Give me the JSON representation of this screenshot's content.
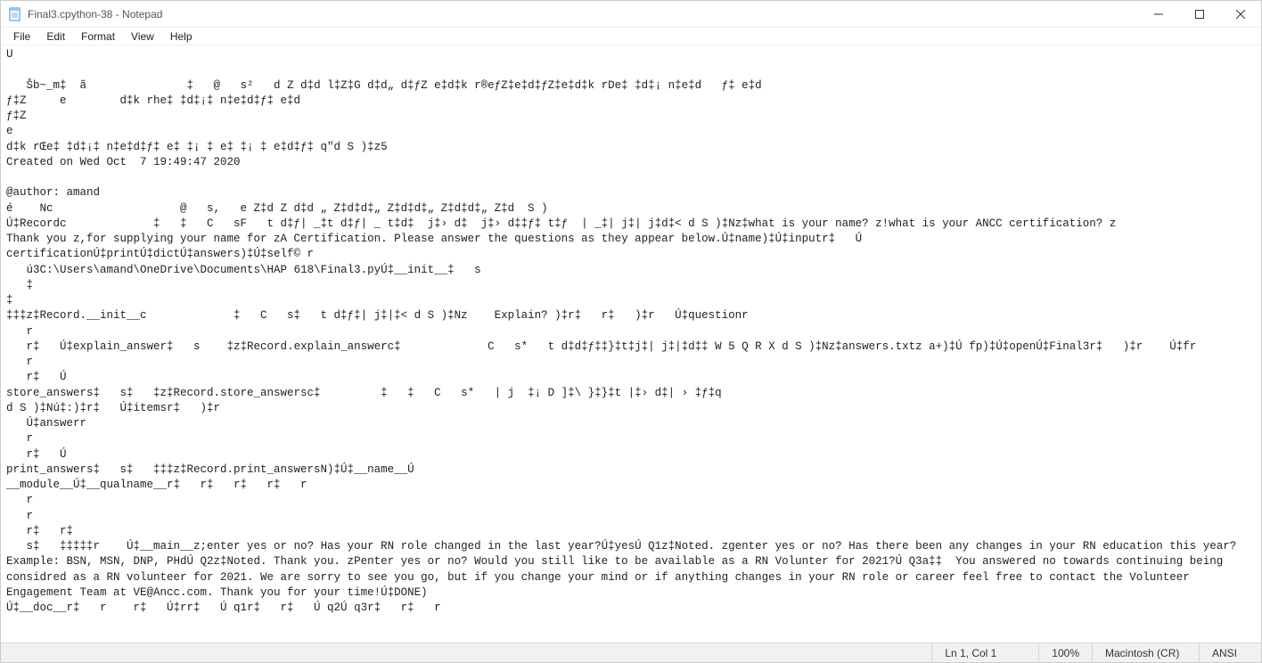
{
  "window": {
    "title": "Final3.cpython-38 - Notepad"
  },
  "menu": {
    "file": "File",
    "edit": "Edit",
    "format": "Format",
    "view": "View",
    "help": "Help"
  },
  "content": "U\n\n   Šb~_m‡  ã               ‡   @   s²   d Z d‡d l‡Z‡G d‡d„ d‡ƒZ e‡d‡k r®eƒZ‡e‡d‡ƒZ‡e‡d‡k rDe‡ ‡d‡¡ n‡e‡d   ƒ‡ e‡d\nƒ‡Z     e        d‡k rhe‡ ‡d‡¡‡ n‡e‡d‡ƒ‡ e‡d\nƒ‡Z\ne\nd‡k rŒe‡ ‡d‡¡‡ n‡e‡d‡ƒ‡ e‡ ‡¡ ‡ e‡ ‡¡ ‡ e‡d‡ƒ‡ q\"d S )‡z5\nCreated on Wed Oct  7 19:49:47 2020\n\n@author: amand\né    Nc                   @   s,   e Z‡d Z d‡d „ Z‡d‡d‡„ Z‡d‡d‡„ Z‡d‡d‡„ Z‡d  S )\nÚ‡Recordc             ‡   ‡   C   sF   t d‡ƒ| _‡t d‡ƒ| _ t‡d‡  j‡› d‡  j‡› d‡‡ƒ‡ t‡ƒ  | _‡| j‡| j‡d‡< d S )‡Nz‡what is your name? z!what is your ANCC certification? z\nThank you z,for supplying your name for zA Certification. Please answer the questions as they appear below.Ú‡name)‡Ú‡inputr‡   Ú\ncertificationÚ‡printÚ‡dictÚ‡answers)‡Ú‡self© r\n   ú3C:\\Users\\amand\\OneDrive\\Documents\\HAP 618\\Final3.pyÚ‡__init__‡   s\n   ‡\n‡\n‡‡‡z‡Record.__init__c             ‡   C   s‡   t d‡ƒ‡| j‡|‡< d S )‡Nz    Explain? )‡r‡   r‡   )‡r   Ú‡questionr\n   r\n   r‡   Ú‡explain_answer‡   s    ‡z‡Record.explain_answerc‡             C   s*   t d‡d‡ƒ‡‡}‡t‡j‡| j‡|‡d‡‡ W 5 Q R X d S )‡Nz‡answers.txtz a+)‡Ú fp)‡Ú‡openÚ‡Final3r‡   )‡r    Ú‡fr\n   r\n   r‡   Ú\nstore_answers‡   s‡   ‡z‡Record.store_answersc‡         ‡   ‡   C   s*   | j  ‡¡ D ]‡\\ }‡}‡t |‡› d‡| › ‡ƒ‡q\nd S )‡Nú‡:)‡r‡   Ú‡itemsr‡   )‡r\n   Ú‡answerr\n   r\n   r‡   Ú\nprint_answers‡   s‡   ‡‡‡z‡Record.print_answersN)‡Ú‡__name__Ú\n__module__Ú‡__qualname__r‡   r‡   r‡   r‡   r\n   r\n   r\n   r‡   r‡\n   s‡   ‡‡‡‡‡r    Ú‡__main__z;enter yes or no? Has your RN role changed in the last year?Ú‡yesÚ Q1z‡Noted. zgenter yes or no? Has there been any changes in your RN education this year? Example: BSN, MSN, DNP, PHdÚ Q2z‡Noted. Thank you. zPenter yes or no? Would you still like to be available as a RN Volunter for 2021?Ú Q3a‡‡  You answered no towards continuing being considred as a RN volunteer for 2021. We are sorry to see you go, but if you change your mind or if anything changes in your RN role or career feel free to contact the Volunteer Engagement Team at VE@Ancc.com. Thank you for your time!Ú‡DONE)\nÚ‡__doc__r‡   r    r‡   Ú‡rr‡   Ú q1r‡   r‡   Ú q2Ú q3r‡   r‡   r\n",
  "status": {
    "position": "Ln 1, Col 1",
    "zoom": "100%",
    "line_ending": "Macintosh (CR)",
    "encoding": "ANSI"
  }
}
